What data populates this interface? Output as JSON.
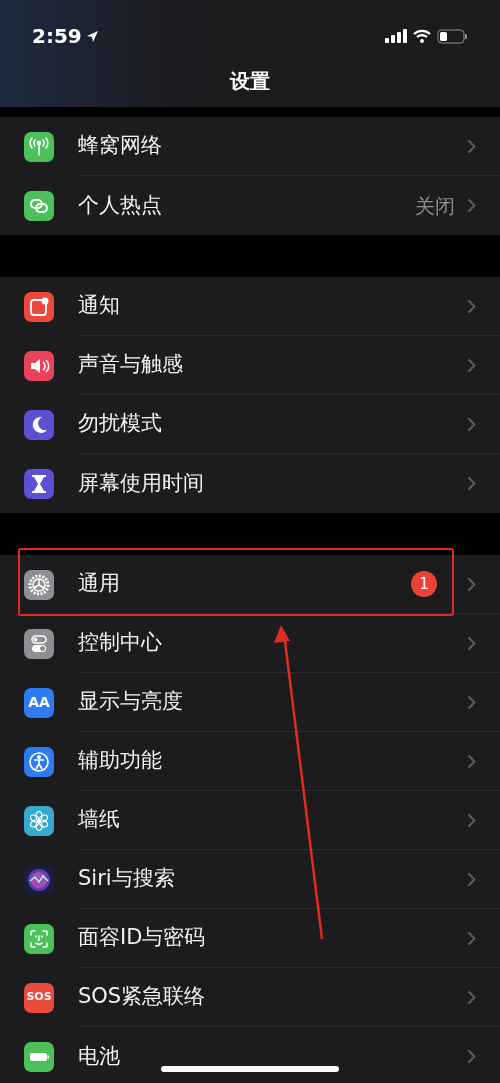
{
  "status_bar": {
    "time": "2:59"
  },
  "title": "设置",
  "groups": [
    {
      "items": [
        {
          "kind": "cellular",
          "label": "蜂窝网络",
          "highlighted": false
        },
        {
          "kind": "hotspot",
          "label": "个人热点",
          "value": "关闭",
          "highlighted": false
        }
      ]
    },
    {
      "items": [
        {
          "kind": "notifications",
          "label": "通知",
          "highlighted": false
        },
        {
          "kind": "sounds",
          "label": "声音与触感",
          "highlighted": false
        },
        {
          "kind": "dnd",
          "label": "勿扰模式",
          "highlighted": false
        },
        {
          "kind": "screentime",
          "label": "屏幕使用时间",
          "highlighted": false
        }
      ]
    },
    {
      "items": [
        {
          "kind": "general",
          "label": "通用",
          "badge": "1",
          "highlighted": true
        },
        {
          "kind": "control",
          "label": "控制中心",
          "highlighted": false
        },
        {
          "kind": "display",
          "label": "显示与亮度",
          "icon_text": "AA",
          "highlighted": false
        },
        {
          "kind": "accessibility",
          "label": "辅助功能",
          "highlighted": false
        },
        {
          "kind": "wallpaper",
          "label": "墙纸",
          "highlighted": false
        },
        {
          "kind": "siri",
          "label": "Siri与搜索",
          "highlighted": false
        },
        {
          "kind": "faceid",
          "label": "面容ID与密码",
          "highlighted": false
        },
        {
          "kind": "sos",
          "label": "SOS紧急联络",
          "icon_text": "SOS",
          "highlighted": false
        },
        {
          "kind": "battery",
          "label": "电池",
          "highlighted": false
        }
      ]
    }
  ]
}
